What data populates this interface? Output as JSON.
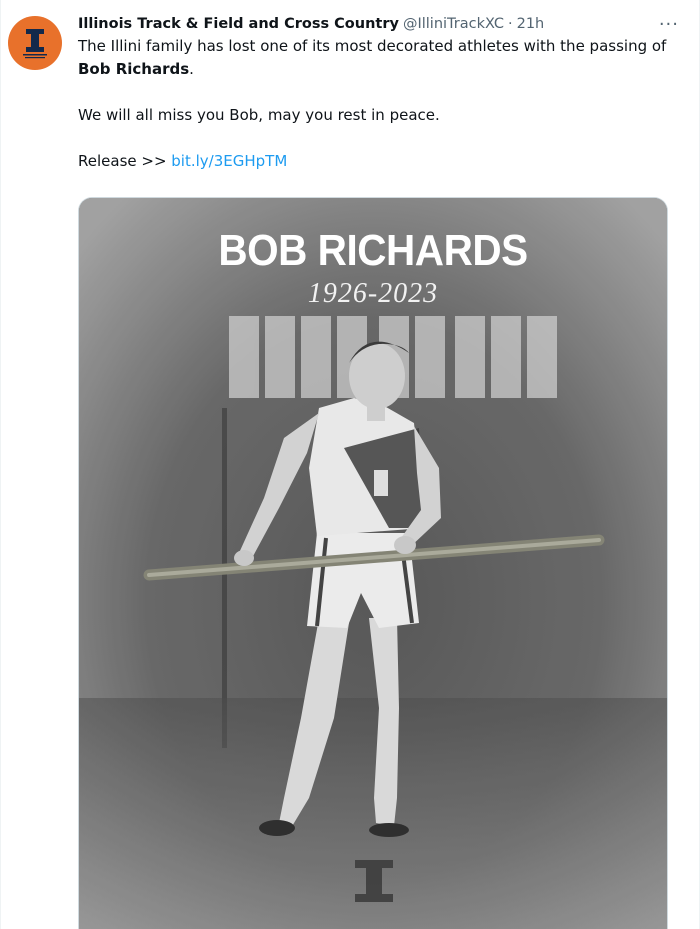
{
  "tweet": {
    "display_name": "Illinois Track & Field and Cross Country",
    "handle": "@IlliniTrackXC",
    "separator": "·",
    "time": "21h",
    "more_icon": "more-horizontal-icon",
    "body_line1_pre": "The Illini family has lost one of its most decorated athletes with the passing of ",
    "body_line1_bold": "Bob Richards",
    "body_line1_post": ".",
    "body_line2": "We will all miss you Bob, may you rest in peace.",
    "release_label": "Release >> ",
    "release_link": "bit.ly/3EGHpTM"
  },
  "media": {
    "title": "BOB RICHARDS",
    "years": "1926-2023"
  },
  "colors": {
    "avatar_bg": "#e8712b",
    "link": "#1d9bf0",
    "muted": "#536471"
  }
}
